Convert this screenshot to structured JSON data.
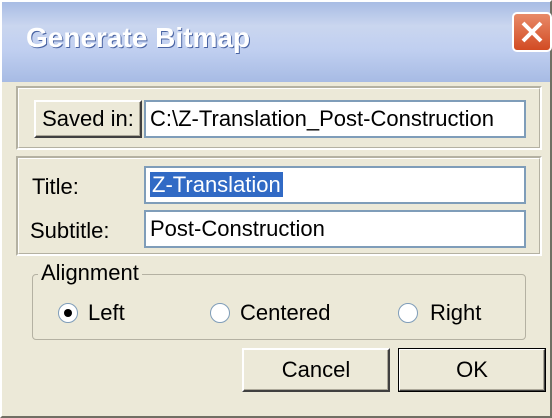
{
  "window": {
    "title": "Generate Bitmap"
  },
  "saved_in": {
    "button_label": "Saved in:",
    "path": "C:\\Z-Translation_Post-Construction"
  },
  "title_field": {
    "label": "Title:",
    "value": "Z-Translation"
  },
  "subtitle_field": {
    "label": "Subtitle:",
    "value": "Post-Construction"
  },
  "alignment": {
    "legend": "Alignment",
    "options": [
      {
        "label": "Left",
        "selected": true
      },
      {
        "label": "Centered",
        "selected": false
      },
      {
        "label": "Right",
        "selected": false
      }
    ]
  },
  "buttons": {
    "cancel": "Cancel",
    "ok": "OK"
  },
  "colors": {
    "selection": "#316ac5",
    "close_button": "#d24b23"
  }
}
